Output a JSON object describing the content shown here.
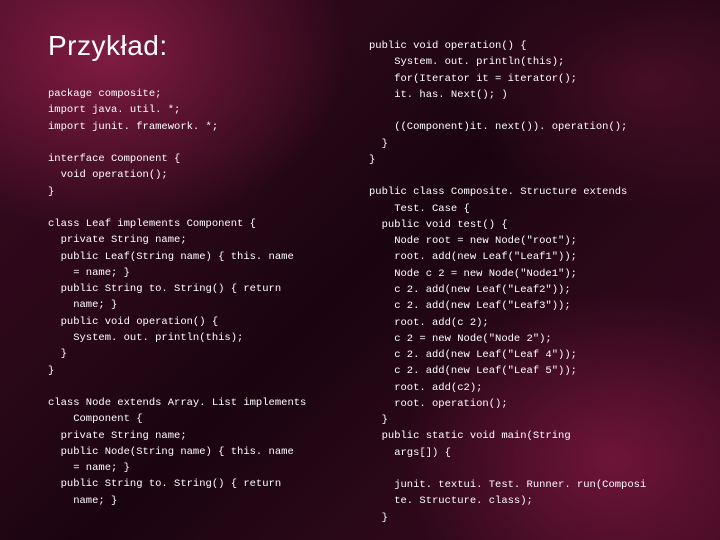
{
  "title": "Przykład:",
  "code_left": "package composite;\nimport java. util. *;\nimport junit. framework. *;\n\ninterface Component {\n  void operation();\n}\n\nclass Leaf implements Component {\n  private String name;\n  public Leaf(String name) { this. name\n    = name; }\n  public String to. String() { return\n    name; }\n  public void operation() {\n    System. out. println(this);\n  }\n}\n\nclass Node extends Array. List implements\n    Component {\n  private String name;\n  public Node(String name) { this. name\n    = name; }\n  public String to. String() { return\n    name; }",
  "code_right": "public void operation() {\n    System. out. println(this);\n    for(Iterator it = iterator();\n    it. has. Next(); )\n\n    ((Component)it. next()). operation();\n  }\n}\n\npublic class Composite. Structure extends\n    Test. Case {\n  public void test() {\n    Node root = new Node(\"root\");\n    root. add(new Leaf(\"Leaf1\"));\n    Node c 2 = new Node(\"Node1\");\n    c 2. add(new Leaf(\"Leaf2\"));\n    c 2. add(new Leaf(\"Leaf3\"));\n    root. add(c 2);\n    c 2 = new Node(\"Node 2\");\n    c 2. add(new Leaf(\"Leaf 4\"));\n    c 2. add(new Leaf(\"Leaf 5\"));\n    root. add(c2);\n    root. operation();\n  }\n  public static void main(String\n    args[]) {\n\n    junit. textui. Test. Runner. run(Composi\n    te. Structure. class);\n  }"
}
